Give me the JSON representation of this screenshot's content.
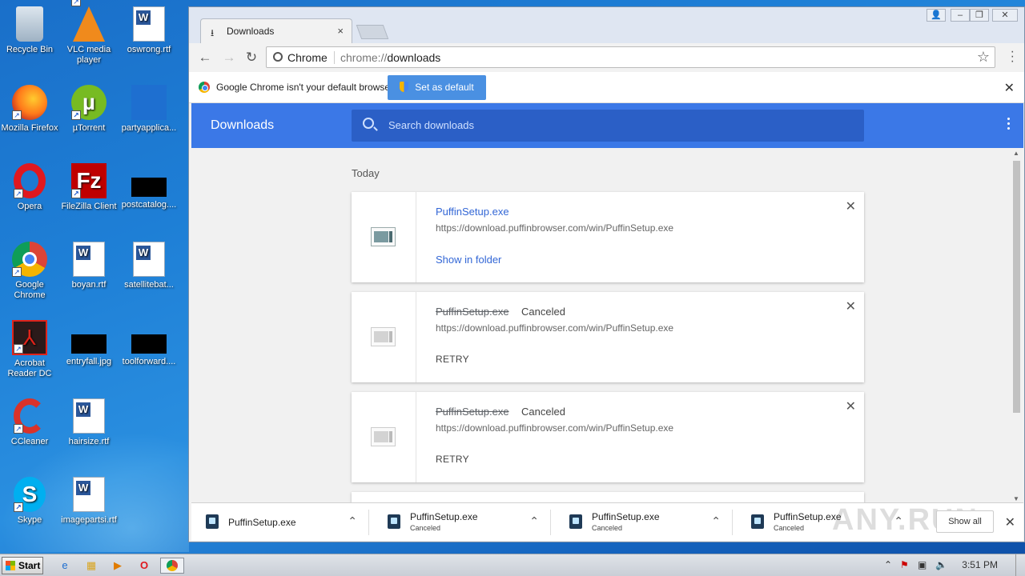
{
  "desktop": {
    "icons": [
      {
        "label": "Recycle Bin"
      },
      {
        "label": "VLC media player"
      },
      {
        "label": "oswrong.rtf"
      },
      {
        "label": "Mozilla Firefox"
      },
      {
        "label": "µTorrent"
      },
      {
        "label": "partyapplica..."
      },
      {
        "label": "Opera"
      },
      {
        "label": "FileZilla Client"
      },
      {
        "label": "postcatalog...."
      },
      {
        "label": "Google Chrome"
      },
      {
        "label": "boyan.rtf"
      },
      {
        "label": "satellitebat..."
      },
      {
        "label": "Acrobat Reader DC"
      },
      {
        "label": "entryfall.jpg"
      },
      {
        "label": "toolforward...."
      },
      {
        "label": "CCleaner"
      },
      {
        "label": "hairsize.rtf"
      },
      {
        "label": "Skype"
      },
      {
        "label": "imagepartsi.rtf"
      }
    ]
  },
  "browser": {
    "tab": {
      "title": "Downloads",
      "close": "×"
    },
    "omnibox": {
      "site": "Chrome",
      "url_scheme": "chrome://",
      "url_path": "downloads"
    },
    "infobar": {
      "message": "Google Chrome isn't your default browser.",
      "button": "Set as default",
      "close": "✕"
    },
    "downloads_page": {
      "title": "Downloads",
      "search_placeholder": "Search downloads",
      "section": "Today",
      "items": [
        {
          "name": "PuffinSetup.exe",
          "status": "",
          "url": "https://download.puffinbrowser.com/win/PuffinSetup.exe",
          "action": "Show in folder",
          "close": "✕"
        },
        {
          "name": "PuffinSetup.exe",
          "status": "Canceled",
          "url": "https://download.puffinbrowser.com/win/PuffinSetup.exe",
          "action": "RETRY",
          "close": "✕"
        },
        {
          "name": "PuffinSetup.exe",
          "status": "Canceled",
          "url": "https://download.puffinbrowser.com/win/PuffinSetup.exe",
          "action": "RETRY",
          "close": "✕"
        }
      ]
    },
    "shelf": {
      "items": [
        {
          "name": "PuffinSetup.exe",
          "sub": ""
        },
        {
          "name": "PuffinSetup.exe",
          "sub": "Canceled"
        },
        {
          "name": "PuffinSetup.exe",
          "sub": "Canceled"
        },
        {
          "name": "PuffinSetup.exe",
          "sub": "Canceled"
        }
      ],
      "show_all": "Show all",
      "close": "✕",
      "watermark": "ANY.RUN"
    }
  },
  "taskbar": {
    "start": "Start",
    "clock": "3:51 PM"
  },
  "colors": {
    "header_blue": "#3b78e7",
    "search_blue": "#2b5fc6",
    "link_blue": "#3367d6",
    "desktop_blue": "#1e7fd6"
  }
}
